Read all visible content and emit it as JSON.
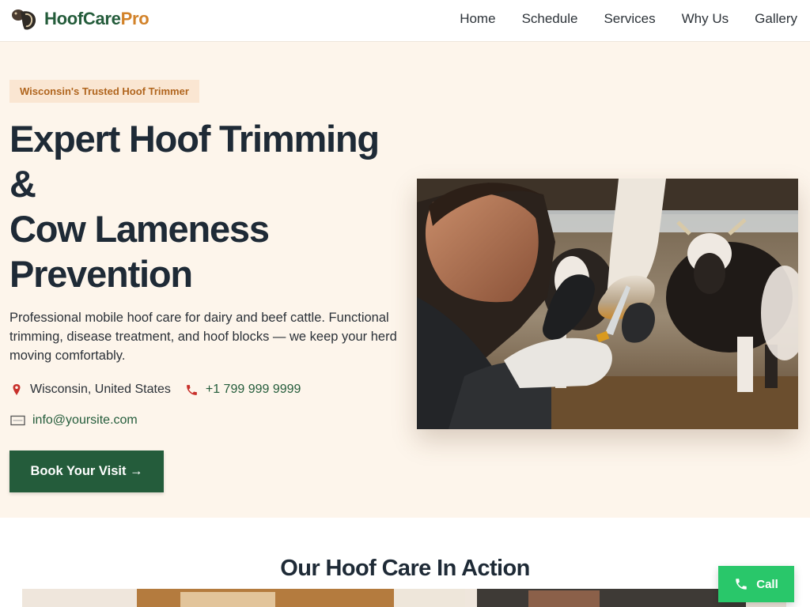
{
  "brand": {
    "name_part1": "HoofCare",
    "name_part2": "Pro",
    "accent_green": "#245c3b",
    "accent_orange": "#d28229"
  },
  "nav": {
    "items": [
      "Home",
      "Schedule",
      "Services",
      "Why Us",
      "Gallery"
    ]
  },
  "hero": {
    "badge": "Wisconsin's Trusted Hoof Trimmer",
    "title_lines": [
      "Expert Hoof Trimming",
      "&",
      "Cow Lameness",
      "Prevention"
    ],
    "description": "Professional mobile hoof care for dairy and beef cattle. Functional trimming, disease treatment, and hoof blocks — we keep your herd moving comfortably.",
    "location": "Wisconsin, United States",
    "phone": "+1 799 999 9999",
    "email": "info@yoursite.com",
    "cta_label": "Book Your Visit →",
    "photo": "hoof-trimmer-with-cow-photo"
  },
  "gallery": {
    "title": "Our Hoof Care In Action"
  },
  "floating": {
    "call_label": "Call"
  }
}
